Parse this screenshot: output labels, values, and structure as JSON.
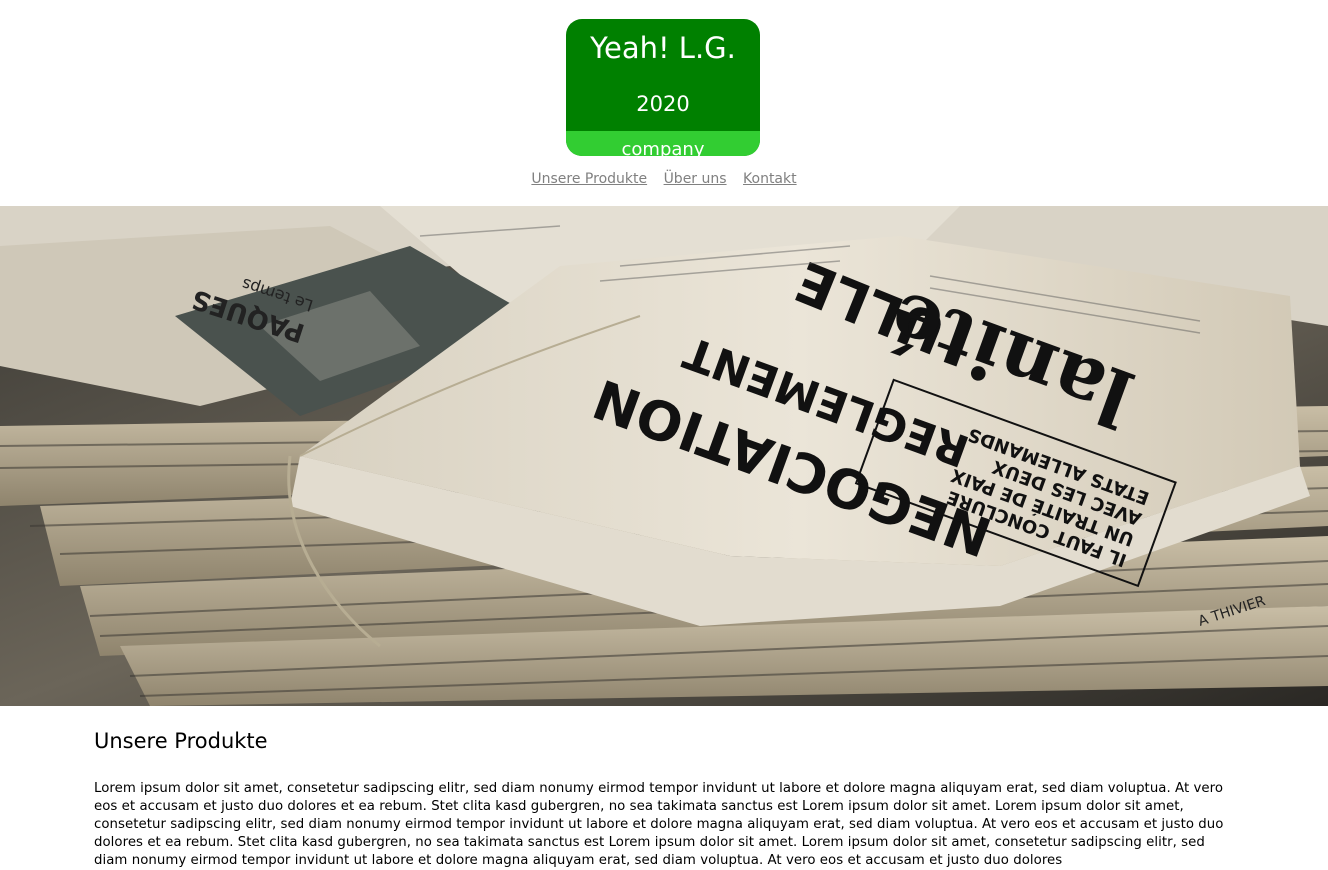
{
  "logo": {
    "name": "Yeah! L.G.",
    "year": "2020",
    "tagline": "company",
    "colors": {
      "primary": "#008000",
      "secondary": "#32cd32"
    }
  },
  "nav": {
    "items": [
      {
        "label": "Unsere Produkte"
      },
      {
        "label": "Über uns"
      },
      {
        "label": "Kontakt"
      }
    ]
  },
  "hero": {
    "headline_1": "NEGOCIATION",
    "headline_2": "ULLE",
    "masthead": "lanité",
    "sub_1": "REGLEMENT",
    "box_lines": [
      "IL FAUT CONCLURE",
      "UN TRAITÉ DE PAIX",
      "AVEC LES DEUX",
      "ETATS ALLEMANDS"
    ],
    "side_1": "PAQUES",
    "side_2": "Le temps",
    "edge_text": "A THIVIER"
  },
  "main": {
    "heading": "Unsere Produkte",
    "body": "Lorem ipsum dolor sit amet, consetetur sadipscing elitr, sed diam nonumy eirmod tempor invidunt ut labore et dolore magna aliquyam erat, sed diam voluptua. At vero eos et accusam et justo duo dolores et ea rebum. Stet clita kasd gubergren, no sea takimata sanctus est Lorem ipsum dolor sit amet. Lorem ipsum dolor sit amet, consetetur sadipscing elitr, sed diam nonumy eirmod tempor invidunt ut labore et dolore magna aliquyam erat, sed diam voluptua. At vero eos et accusam et justo duo dolores et ea rebum. Stet clita kasd gubergren, no sea takimata sanctus est Lorem ipsum dolor sit amet. Lorem ipsum dolor sit amet, consetetur sadipscing elitr, sed diam nonumy eirmod tempor invidunt ut labore et dolore magna aliquyam erat, sed diam voluptua. At vero eos et accusam et justo duo dolores"
  }
}
